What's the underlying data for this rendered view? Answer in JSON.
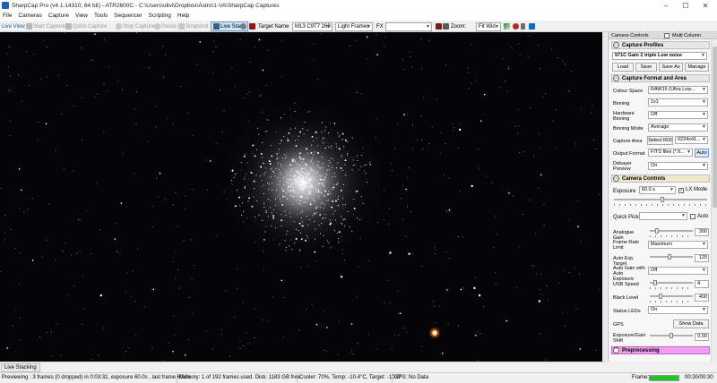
{
  "window": {
    "title": "SharpCap Pro (v4.1.14310, 64 bit) - ATR2600C - C:\\Users\\olivi\\Dropbox\\Astro\\1-VA\\SharpCap Captures",
    "controls": [
      "–",
      "☐",
      "✕"
    ]
  },
  "menu": [
    "File",
    "Cameras",
    "Capture",
    "View",
    "Tools",
    "Sequencer",
    "Scripting",
    "Help"
  ],
  "toolbar": {
    "live_view": "Live View",
    "start_capture": "Start Capture",
    "quick_capture": "Quick Capture",
    "stop_capture": "Stop Capture",
    "pause": "Pause",
    "snapshot": "Snapshot",
    "live_stack": "Live Stack",
    "target_name_label": "Target Name",
    "target_name_value": "M13 C9T7 260",
    "frame_type": "Light Frames",
    "fx_label": "FX",
    "fx_value": "",
    "zoom_label": "Zoom:",
    "zoom_value": "Fit Wid"
  },
  "bottom_tab": "Live Stacking",
  "status": {
    "preview": "Previewing : 3 frames (0 dropped) in 0:03:32, exposure 60.0s , last frame 60.0s",
    "memory": "Memory: 1 of 192 frames used. Disk: 1183 GB free",
    "cooler": "Cooler: 70%, Temp: -10.4°C, Target: -10.0°",
    "gps": "GPS: No Data",
    "frame_label": "Frame:",
    "frame_progress": 1.0,
    "time": "00:30/00:30",
    "colors": {
      "progress": "#22c322"
    }
  },
  "panel": {
    "header": "Camera Controls",
    "multi_column": "Multi Column",
    "capture_profiles": {
      "title": "Capture Profiles",
      "profile": "571C Gain 2 triple Low noise",
      "buttons": [
        "Load",
        "Save",
        "Save As",
        "Manage"
      ]
    },
    "capture_format": {
      "title": "Capture Format and Area",
      "rows": [
        {
          "label": "Colour Space",
          "value": "RAW16 (Ultra Low..."
        },
        {
          "label": "Binning",
          "value": "1x1"
        },
        {
          "label": "Hardware Binning",
          "value": "Off"
        },
        {
          "label": "Binning Mode",
          "value": "Average"
        },
        {
          "label": "Capture Area",
          "button": "Select ROI",
          "value": "6224x41..."
        },
        {
          "label": "Output Format",
          "value": "FITS files (*.fi...",
          "button": "Auto"
        },
        {
          "label": "Debayer Preview",
          "value": "On"
        }
      ]
    },
    "camera_controls": {
      "title": "Camera Controls",
      "exposure_label": "Exposure",
      "exposure_value": "60.0 s",
      "lx_mode": "LX Mode",
      "quick_picks": "Quick Picks",
      "auto": "Auto",
      "analogue_gain_label": "Analogue Gain",
      "analogue_gain": "300",
      "frame_rate_label": "Frame Rate Limit",
      "frame_rate": "Maximum",
      "auto_exp_target_label": "Auto Exp Target",
      "auto_exp_target": "120",
      "auto_gain_label": "Auto Gain with Auto Exposure",
      "auto_gain": "Off",
      "usb_speed_label": "USB Speed",
      "usb_speed": "4",
      "black_level_label": "Black Level",
      "black_level": "400",
      "status_leds_label": "Status LEDs",
      "status_leds": "On",
      "gps_label": "GPS",
      "gps_button": "Show Data",
      "exposure_shift_label": "Exposure/Gain Shift",
      "exposure_shift": "0.00"
    },
    "preprocessing": {
      "title": "Preprocessing"
    }
  }
}
